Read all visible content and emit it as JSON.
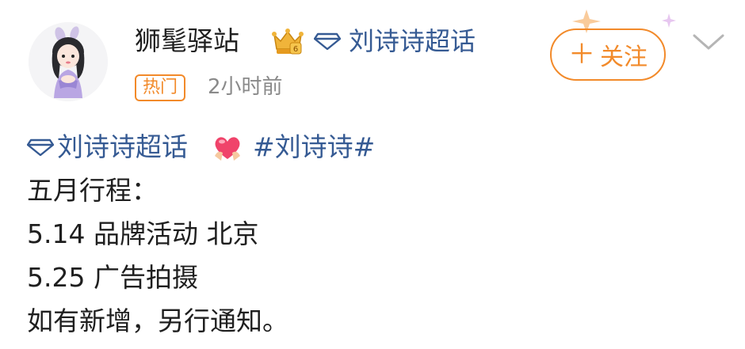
{
  "post": {
    "username": "狮髦驿站",
    "topic": "刘诗诗超话",
    "hot_tag": "热门",
    "time": "2小时前",
    "follow_label": "关注",
    "follow_plus": "＋",
    "body": {
      "tag_topic": "刘诗诗超话",
      "hashtag": "#刘诗诗#",
      "lines": [
        "五月行程：",
        "5.14 品牌活动 北京",
        "5.25 广告拍摄",
        "如有新增，另行通知。"
      ]
    }
  },
  "colors": {
    "accent": "#f28a2a",
    "link": "#355a93",
    "muted": "#8a8a8a"
  },
  "icons": {
    "vip": "crown-badge-icon",
    "topic": "diamond-icon",
    "chevron": "chevron-down-icon",
    "heart": "heart-hands-icon"
  }
}
